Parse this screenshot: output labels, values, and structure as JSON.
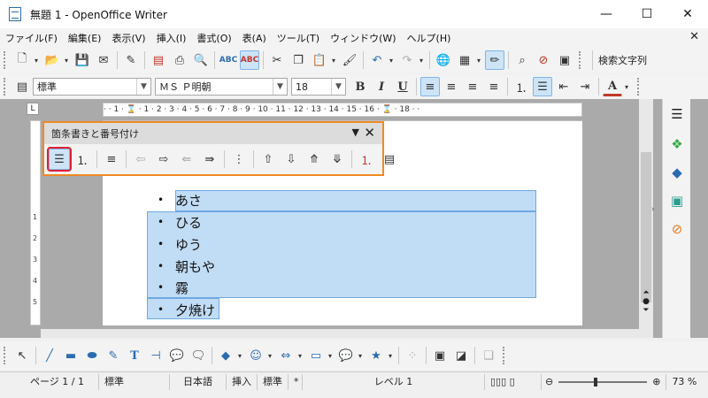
{
  "window": {
    "title": "無題 1 - OpenOffice Writer",
    "minimize": "—",
    "maximize": "☐",
    "close": "✕"
  },
  "menu": {
    "items": [
      "ファイル(F)",
      "編集(E)",
      "表示(V)",
      "挿入(I)",
      "書式(O)",
      "表(A)",
      "ツール(T)",
      "ウィンドウ(W)",
      "ヘルプ(H)"
    ],
    "close_doc": "✕"
  },
  "standard_toolbar": {
    "find_label": "検索文字列"
  },
  "format_toolbar": {
    "paragraph_style": "標準",
    "font_name": "ＭＳ Ｐ明朝",
    "font_size": "18",
    "bold": "B",
    "italic": "I",
    "underline": "U",
    "font_color": "A"
  },
  "ruler": {
    "text": "· · 1 · ⌛ · 1 · 2 · 3 · 4 · 5 · 6 · 7 · 8 · 9 · 10 · 11 · 12 · 13 · 14 · 15 · 16 · ⌛ · 18 · ·",
    "vertical_ticks": [
      "1",
      "2",
      "3",
      "4",
      "5"
    ],
    "corner": "L"
  },
  "floating_toolbar": {
    "title": "箇条書きと番号付け",
    "menu_arrow": "▼",
    "close": "✕"
  },
  "document": {
    "list_items": [
      "あさ",
      "ひる",
      "ゆう",
      "朝もや",
      "霧",
      "夕焼け"
    ],
    "bullet": "•"
  },
  "status": {
    "page": "ページ 1 / 1",
    "style": "標準",
    "language": "日本語",
    "insert_mode": "挿入",
    "selection_mode": "標準",
    "modified": "*",
    "level": "レベル 1",
    "zoom": "73 %",
    "zoom_minus": "⊖",
    "zoom_plus": "⊕"
  },
  "colors": {
    "accent_orange": "#f08a24",
    "highlight_red": "#e02030",
    "selection_blue": "#c1dcf5"
  }
}
